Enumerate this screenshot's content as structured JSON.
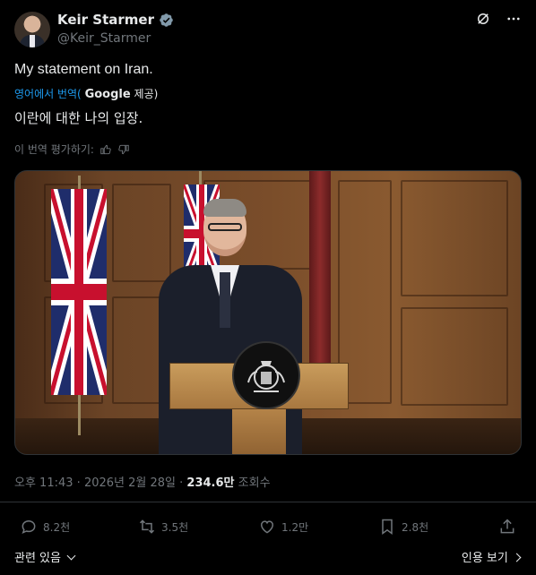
{
  "author": {
    "name": "Keir Starmer",
    "handle": "@Keir_Starmer"
  },
  "tweet": {
    "text": "My statement on Iran.",
    "translated_by_prefix": "영어에서 번역(",
    "translated_by_provider": "Google",
    "translated_by_suffix": "제공)",
    "translation": "이란에 대한 나의 입장.",
    "rate_translation": "이 번역 평가하기:"
  },
  "meta": {
    "time": "오후 11:43",
    "separator1": "·",
    "date": "2026년 2월 28일",
    "separator2": "·",
    "views_count": "234.6만",
    "views_label": "조회수"
  },
  "actions": {
    "replies": "8.2천",
    "reposts": "3.5천",
    "likes": "1.2만",
    "bookmarks": "2.8천"
  },
  "footer": {
    "related_label": "관련 있음",
    "quotes_label": "인용 보기"
  },
  "colors": {
    "background": "#000000",
    "text_primary": "#e7e9ea",
    "text_secondary": "#71767b",
    "link": "#1d9bf0",
    "verified": "#829aab"
  },
  "icons": {
    "verified": "verified-badge-icon",
    "grok": "grok-icon",
    "more": "more-icon",
    "thumbs_up": "thumbs-up-icon",
    "thumbs_down": "thumbs-down-icon",
    "reply": "reply-icon",
    "repost": "repost-icon",
    "like": "heart-icon",
    "bookmark": "bookmark-icon",
    "share": "share-icon"
  }
}
